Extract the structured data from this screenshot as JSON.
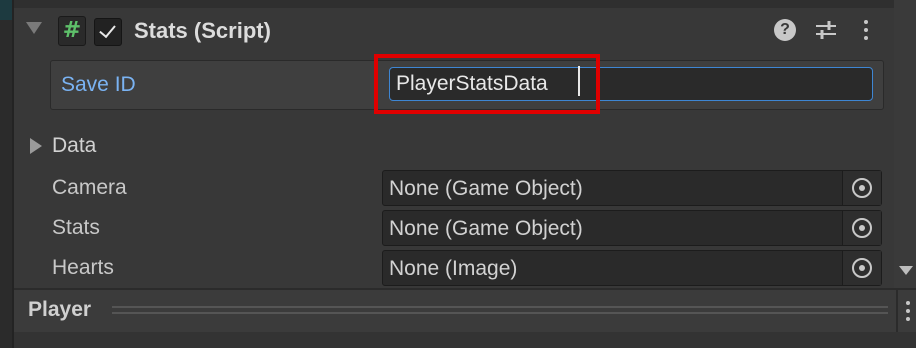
{
  "component": {
    "title": "Stats (Script)",
    "enabled": true
  },
  "save_id": {
    "label": "Save ID",
    "value": "PlayerStatsData"
  },
  "data_foldout": {
    "label": "Data"
  },
  "fields": [
    {
      "label": "Camera",
      "value": "None (Game Object)"
    },
    {
      "label": "Stats",
      "value": "None (Game Object)"
    },
    {
      "label": "Hearts",
      "value": "None (Image)"
    }
  ],
  "player": {
    "title": "Player"
  },
  "icons": {
    "script": "hash-icon",
    "help": "help-icon",
    "presets": "presets-icon",
    "menu": "kebab-menu-icon",
    "picker": "object-picker-icon"
  },
  "colors": {
    "highlight": "#e00000",
    "focus_border": "#3e86d3",
    "label_focus": "#7ab3f3"
  }
}
